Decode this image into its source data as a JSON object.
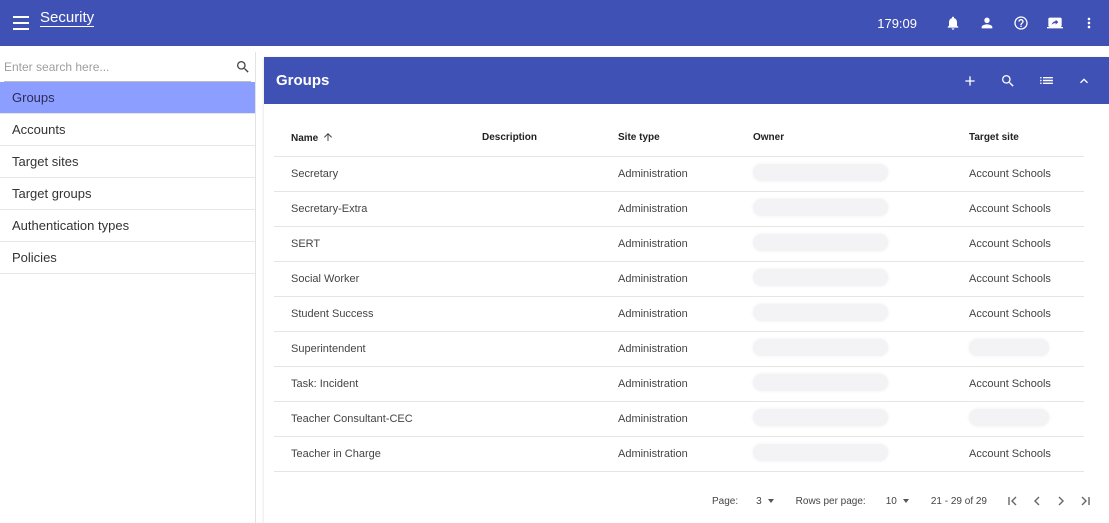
{
  "app": {
    "title": "Security",
    "clock": "179:09"
  },
  "topbar_icons": [
    "menu-icon",
    "bell-icon",
    "person-icon",
    "help-icon",
    "screen-share-icon",
    "more-vert-icon"
  ],
  "sidebar": {
    "search_placeholder": "Enter search here...",
    "items": [
      {
        "label": "Groups",
        "active": true
      },
      {
        "label": "Accounts"
      },
      {
        "label": "Target sites"
      },
      {
        "label": "Target groups"
      },
      {
        "label": "Authentication types"
      },
      {
        "label": "Policies"
      }
    ]
  },
  "panel": {
    "title": "Groups",
    "columns": {
      "name": "Name",
      "description": "Description",
      "site_type": "Site type",
      "owner": "Owner",
      "target_site": "Target site"
    },
    "rows": [
      {
        "name": "Secretary",
        "description": "",
        "site_type": "Administration",
        "owner": "",
        "target_site": "Account Schools"
      },
      {
        "name": "Secretary-Extra",
        "description": "",
        "site_type": "Administration",
        "owner": "",
        "target_site": "Account Schools"
      },
      {
        "name": "SERT",
        "description": "",
        "site_type": "Administration",
        "owner": "",
        "target_site": "Account Schools"
      },
      {
        "name": "Social Worker",
        "description": "",
        "site_type": "Administration",
        "owner": "",
        "target_site": "Account Schools"
      },
      {
        "name": "Student Success",
        "description": "",
        "site_type": "Administration",
        "owner": "",
        "target_site": "Account Schools"
      },
      {
        "name": "Superintendent",
        "description": "",
        "site_type": "Administration",
        "owner": "",
        "target_site": ""
      },
      {
        "name": "Task: Incident",
        "description": "",
        "site_type": "Administration",
        "owner": "",
        "target_site": "Account Schools"
      },
      {
        "name": "Teacher Consultant-CEC",
        "description": "",
        "site_type": "Administration",
        "owner": "",
        "target_site": ""
      },
      {
        "name": "Teacher in Charge",
        "description": "",
        "site_type": "Administration",
        "owner": "",
        "target_site": "Account Schools"
      }
    ],
    "pager": {
      "page_label": "Page:",
      "page_value": "3",
      "rows_label": "Rows per page:",
      "rows_value": "10",
      "range": "21 - 29 of 29"
    }
  },
  "colors": {
    "primary": "#3f51b5",
    "active_nav": "#8c9eff"
  }
}
